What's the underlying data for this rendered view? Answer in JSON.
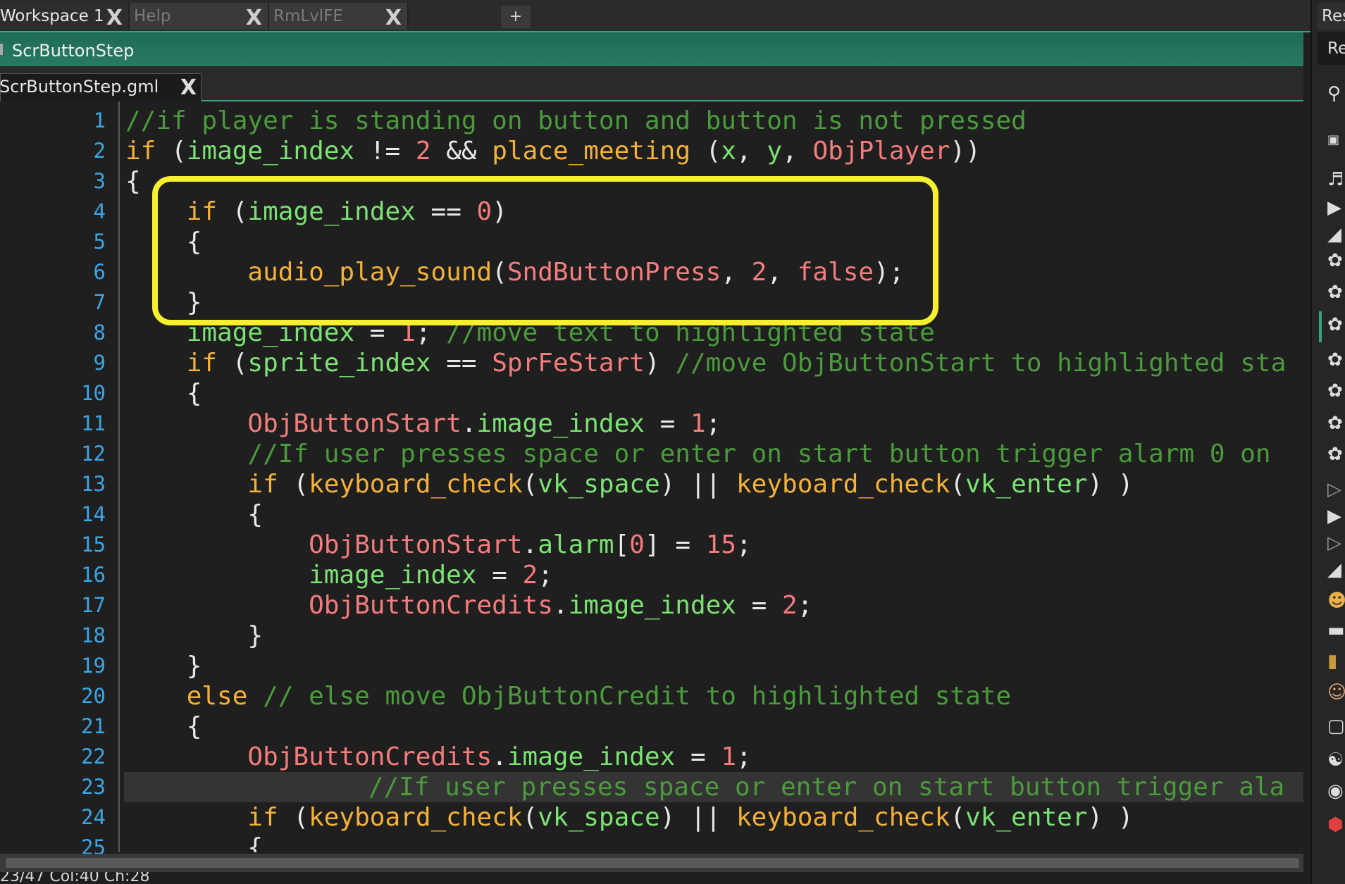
{
  "workspace_tabs": [
    {
      "label": "Workspace 1",
      "active": true
    },
    {
      "label": "Help",
      "active": false
    },
    {
      "label": "RmLvlFE",
      "active": false
    }
  ],
  "add_tab_label": "+",
  "editor": {
    "title": "ScrButtonStep",
    "file_tab": "ScrButtonStep.gml"
  },
  "code_lines": [
    "//if player is standing on button and button is not pressed",
    "if (image_index != 2 && place_meeting (x, y, ObjPlayer))",
    "{",
    "    if (image_index == 0)",
    "    {",
    "        audio_play_sound(SndButtonPress, 2, false);",
    "    }",
    "    image_index = 1; //move text to highlighted state",
    "    if (sprite_index == SprFeStart) //move ObjButtonStart to highlighted sta",
    "    {",
    "        ObjButtonStart.image_index = 1;",
    "        //If user presses space or enter on start button trigger alarm 0 on",
    "        if (keyboard_check(vk_space) || keyboard_check(vk_enter) )",
    "        {",
    "            ObjButtonStart.alarm[0] = 15;",
    "            image_index = 2;",
    "            ObjButtonCredits.image_index = 2;",
    "        }",
    "    }",
    "    else // else move ObjButtonCredit to highlighted state",
    "    {",
    "        ObjButtonCredits.image_index = 1;",
    "                //If user presses space or enter on start button trigger ala",
    "        if (keyboard_check(vk_space) || keyboard_check(vk_enter) )",
    "        {"
  ],
  "line_numbers": [
    "1",
    "2",
    "3",
    "4",
    "5",
    "6",
    "7",
    "8",
    "9",
    "10",
    "11",
    "12",
    "13",
    "14",
    "15",
    "16",
    "17",
    "18",
    "19",
    "20",
    "21",
    "22",
    "23",
    "24",
    "25"
  ],
  "current_line": 23,
  "status_text": "23/47 Col:40 Ch:28",
  "dock": {
    "tab_label": "Res",
    "header_label": "Re"
  },
  "colors": {
    "accent": "#3ba37f",
    "highlight_box": "#f5ef2f",
    "keyword": "#f4b13a",
    "identifier": "#7be273",
    "number": "#f47c7c",
    "comment": "#4b9a3c",
    "line_number": "#3aa6e6"
  }
}
